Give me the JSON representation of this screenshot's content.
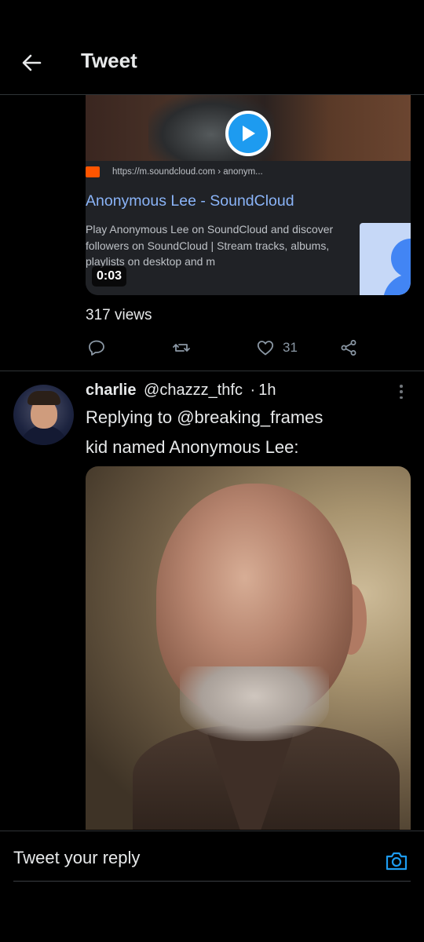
{
  "header": {
    "title": "Tweet",
    "back_icon": "arrow-left-icon"
  },
  "first_tweet": {
    "card": {
      "url": "https://m.soundcloud.com › anonym...",
      "title": "Anonymous Lee - SoundCloud",
      "description": "Play Anonymous Lee on SoundCloud and discover followers on SoundCloud | Stream tracks, albums, playlists on desktop and m",
      "video_time": "0:03"
    },
    "views": "317 views",
    "actions": {
      "like_count": "31"
    }
  },
  "second_tweet": {
    "name": "charlie",
    "handle": "@chazzz_thfc",
    "dot": "·",
    "time": "1h",
    "replying_prefix": "Replying to",
    "replying_to": "@breaking_frames",
    "text": "kid named Anonymous Lee:"
  },
  "reply": {
    "placeholder": "Tweet your reply"
  },
  "colors": {
    "accent": "#1d9bf0",
    "background": "#000000",
    "muted": "#8b98a5",
    "link": "#8ab4f8"
  }
}
